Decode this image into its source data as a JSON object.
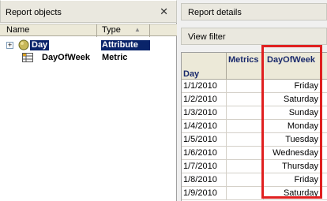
{
  "left_panel": {
    "title": "Report objects",
    "close_glyph": "✕",
    "columns": {
      "name": "Name",
      "type": "Type"
    },
    "items": [
      {
        "name": "Day",
        "type": "Attribute",
        "icon": "attribute-icon",
        "expander": "+"
      },
      {
        "name": "DayOfWeek",
        "type": "Metric",
        "icon": "metric-icon"
      }
    ]
  },
  "right_panel": {
    "report_details": "Report details",
    "view_filter": "View filter",
    "grid": {
      "row_header": "Day",
      "metrics_header": "Metrics",
      "column_header": "DayOfWeek",
      "rows": [
        {
          "date": "1/1/2010",
          "value": "Friday"
        },
        {
          "date": "1/2/2010",
          "value": "Saturday"
        },
        {
          "date": "1/3/2010",
          "value": "Sunday"
        },
        {
          "date": "1/4/2010",
          "value": "Monday"
        },
        {
          "date": "1/5/2010",
          "value": "Tuesday"
        },
        {
          "date": "1/6/2010",
          "value": "Wednesday"
        },
        {
          "date": "1/7/2010",
          "value": "Thursday"
        },
        {
          "date": "1/8/2010",
          "value": "Friday"
        },
        {
          "date": "1/9/2010",
          "value": "Saturday"
        }
      ]
    }
  },
  "colors": {
    "highlight": "#e02020",
    "selection": "#0a246a"
  }
}
